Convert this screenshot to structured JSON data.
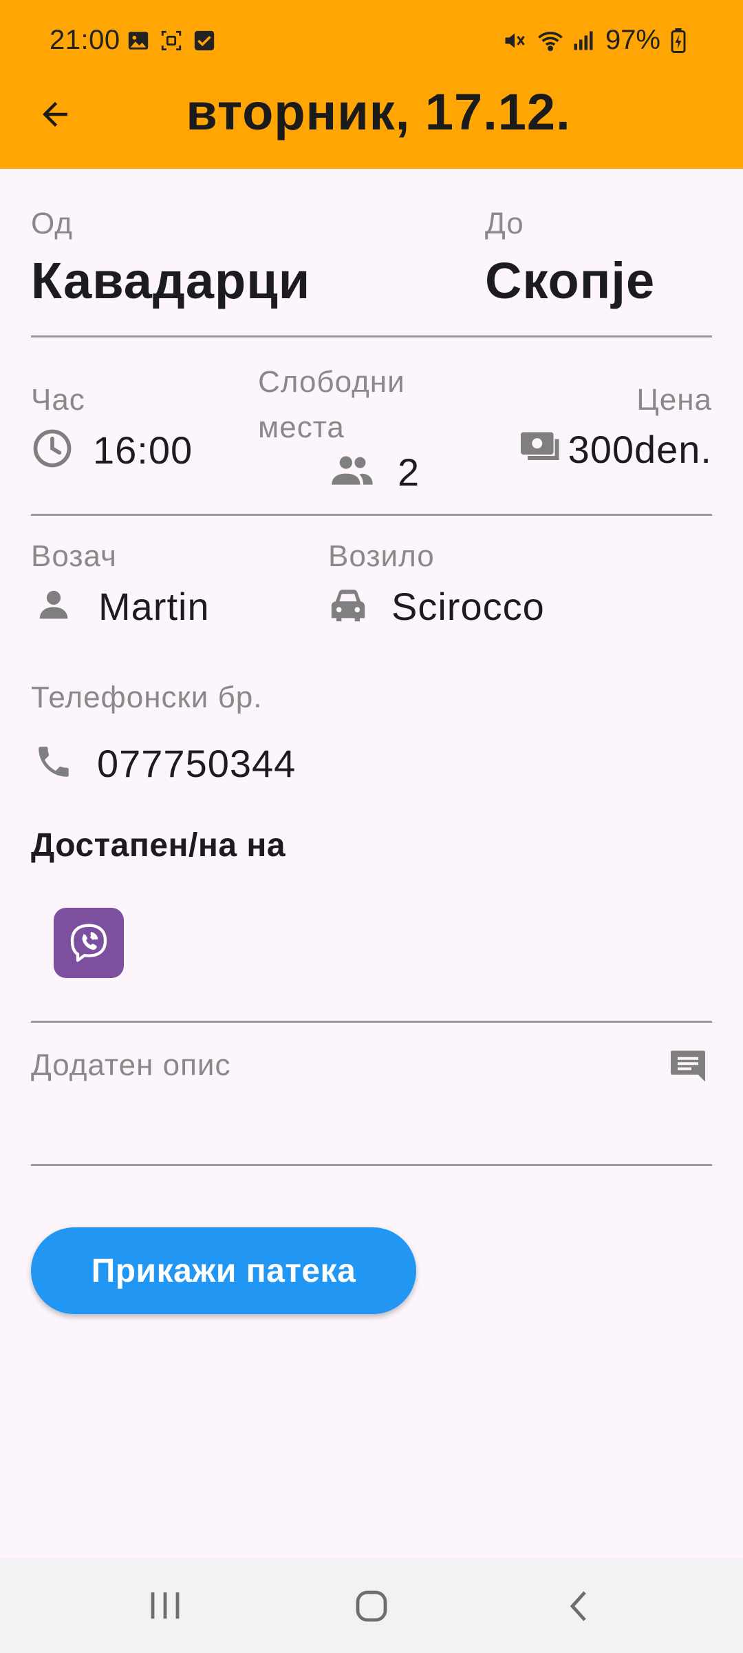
{
  "status_bar": {
    "time": "21:00",
    "battery": "97%",
    "icons_left": [
      "gallery-icon",
      "screenshot-icon",
      "checkbox-icon"
    ],
    "icons_right": [
      "mute-icon",
      "wifi-icon",
      "signal-icon",
      "battery-charging-icon"
    ]
  },
  "header": {
    "title": "вторник, 17.12.",
    "background": "#FFA605"
  },
  "route": {
    "from_label": "Од",
    "from_value": "Кавадарци",
    "to_label": "До",
    "to_value": "Скопје"
  },
  "details": {
    "time_label": "Час",
    "time_value": "16:00",
    "seats_label": "Слободни места",
    "seats_value": "2",
    "price_label": "Цена",
    "price_value": "300den."
  },
  "driver": {
    "driver_label": "Возач",
    "driver_value": "Martin",
    "vehicle_label": "Возило",
    "vehicle_value": "Scirocco",
    "phone_label": "Телефонски бр.",
    "phone_value": "077750344"
  },
  "availability": {
    "title": "Достапен/на на",
    "apps": [
      "viber-icon"
    ]
  },
  "description": {
    "label": "Додатен опис"
  },
  "actions": {
    "show_route": "Прикажи патека",
    "button_color": "#2196F3"
  },
  "nav": {
    "buttons": [
      "recents-icon",
      "home-icon",
      "back-icon"
    ]
  }
}
